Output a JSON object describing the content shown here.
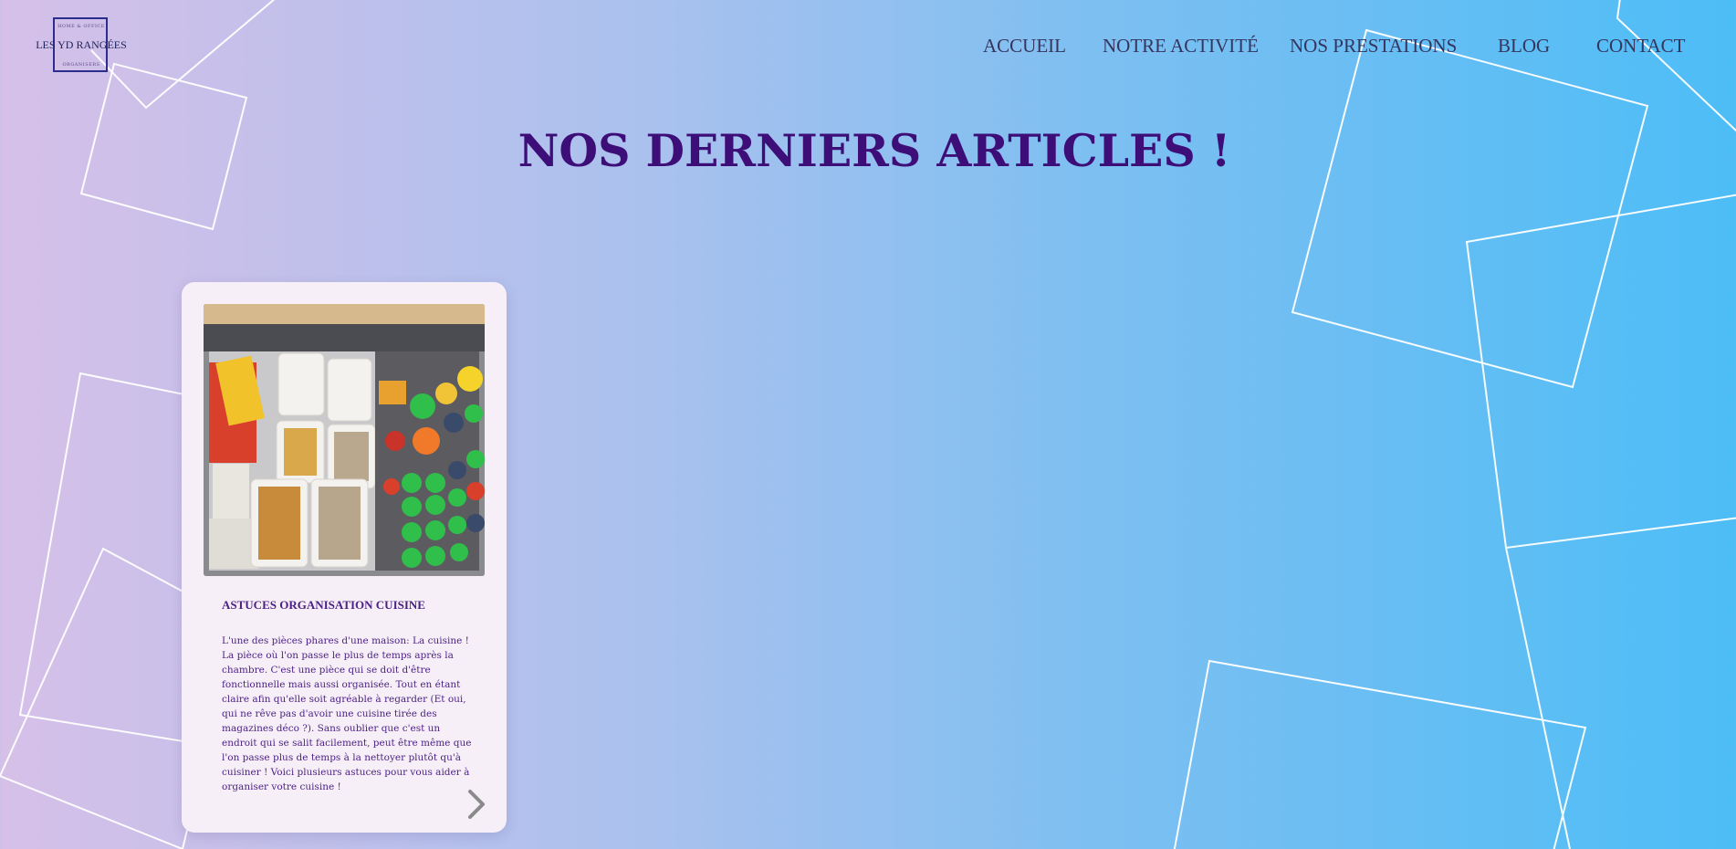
{
  "logo": {
    "top_text": "HOME & OFFICE",
    "name": "LES YD RANGÉES",
    "bottom_text": "ORGANISERS"
  },
  "nav": {
    "items": [
      {
        "label": "ACCUEIL"
      },
      {
        "label": "NOTRE ACTIVITÉ"
      },
      {
        "label": "NOS PRESTATIONS"
      },
      {
        "label": "BLOG"
      },
      {
        "label": "CONTACT"
      }
    ]
  },
  "page": {
    "title": "NOS DERNIERS ARTICLES !"
  },
  "article": {
    "title": "ASTUCES ORGANISATION CUISINE",
    "excerpt": "L'une des pièces phares d'une maison: La cuisine ! La pièce où l'on passe le plus de temps après la chambre. C'est une pièce qui se doit d'être fonctionnelle mais aussi organisée.  Tout en étant claire afin qu'elle soit agréable à regarder (Et oui, qui ne rêve pas d'avoir une cuisine tirée des magazines déco ?). Sans oublier que c'est un endroit qui se salit facilement, peut être même que l'on passe plus de temps à la nettoyer plutôt qu'à cuisiner ! Voici plusieurs astuces pour vous aider à organiser votre cuisine !",
    "next_icon": "chevron-right-icon"
  },
  "colors": {
    "background_left": "#d6c0e8",
    "background_right": "#4dbdf6",
    "title": "#3e0e78",
    "card_text": "#4a1f86",
    "card_bg": "#f7eff7"
  }
}
